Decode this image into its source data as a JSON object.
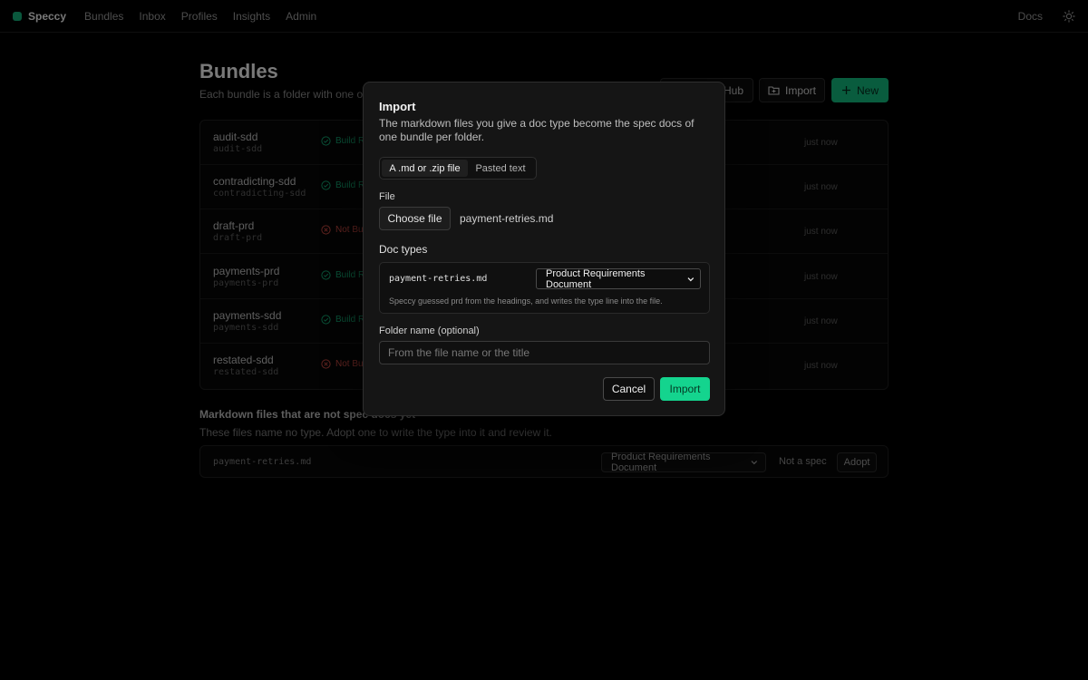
{
  "nav": {
    "brand": "Speccy",
    "links": [
      "Bundles",
      "Inbox",
      "Profiles",
      "Insights",
      "Admin"
    ],
    "docs": "Docs"
  },
  "page": {
    "title": "Bundles",
    "subtitle": "Each bundle is a folder with one or m",
    "hub_label": "Hub",
    "import_label": "Import",
    "new_label": "New"
  },
  "bundles": [
    {
      "name": "audit-sdd",
      "slug": "audit-sdd",
      "status": "Build R",
      "ok": true,
      "time": "just now"
    },
    {
      "name": "contradicting-sdd",
      "slug": "contradicting-sdd",
      "status": "Build R",
      "ok": true,
      "time": "just now"
    },
    {
      "name": "draft-prd",
      "slug": "draft-prd",
      "status": "Not Bu",
      "ok": false,
      "time": "just now"
    },
    {
      "name": "payments-prd",
      "slug": "payments-prd",
      "status": "Build R",
      "ok": true,
      "time": "just now"
    },
    {
      "name": "payments-sdd",
      "slug": "payments-sdd",
      "status": "Build R",
      "ok": true,
      "time": "just now"
    },
    {
      "name": "restated-sdd",
      "slug": "restated-sdd",
      "status": "Not Bu",
      "ok": false,
      "time": "just now"
    }
  ],
  "markdown": {
    "title": "Markdown files that are not spec docs yet",
    "subtitle": "These files name no type. Adopt one to write the type into it and review it.",
    "file": "payment-retries.md",
    "select": "Product Requirements Document",
    "not_spec": "Not a spec",
    "adopt": "Adopt"
  },
  "modal": {
    "title": "Import",
    "description": "The markdown files you give a doc type become the spec docs of one bundle per folder.",
    "tabs": [
      "A .md or .zip file",
      "Pasted text"
    ],
    "file_label": "File",
    "choose_file": "Choose file",
    "file_name": "payment-retries.md",
    "doc_types_label": "Doc types",
    "doc_file": "payment-retries.md",
    "doc_type_selected": "Product Requirements Document",
    "doc_type_hint": "Speccy guessed prd from the headings, and writes the type line into the file.",
    "folder_label": "Folder name (optional)",
    "folder_placeholder": "From the file name or the title",
    "cancel": "Cancel",
    "import": "Import"
  },
  "colors": {
    "accent": "#14d48e",
    "ok": "#13a06d",
    "bad": "#c0463f",
    "background": "#000000"
  }
}
